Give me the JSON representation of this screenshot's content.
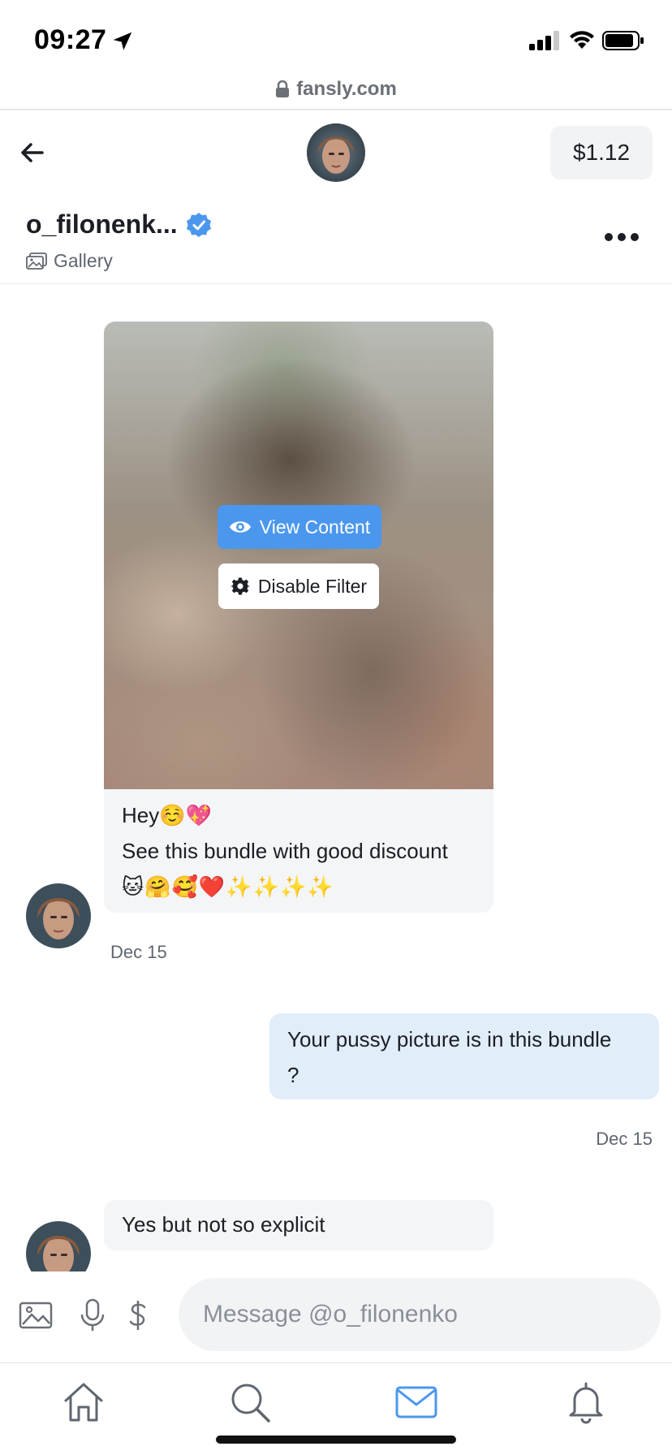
{
  "status_bar": {
    "time": "09:27",
    "icons": [
      "location-arrow-icon",
      "cellular-signal-icon",
      "wifi-icon",
      "battery-icon"
    ]
  },
  "browser": {
    "url": "fansly.com"
  },
  "header": {
    "balance": "$1.12",
    "profile_name": "o_filonenk...",
    "gallery_label": "Gallery"
  },
  "media": {
    "view_content_label": "View Content",
    "disable_filter_label": "Disable Filter"
  },
  "messages": [
    {
      "direction": "incoming",
      "lines": [
        "Hey☺️💖",
        "See this bundle with good discount",
        "🐱🤗🥰❤️✨✨✨✨"
      ],
      "timestamp": "Dec 15"
    },
    {
      "direction": "outgoing",
      "lines": [
        "Your pussy picture is in this bundle",
        "?"
      ],
      "timestamp": "Dec 15"
    },
    {
      "direction": "incoming",
      "lines": [
        "Yes but not so explicit"
      ]
    }
  ],
  "composer": {
    "placeholder": "Message @o_filonenko"
  },
  "colors": {
    "accent": "#4b97ee",
    "outgoing_bubble": "#e1edf9",
    "incoming_bubble": "#f4f5f7"
  }
}
